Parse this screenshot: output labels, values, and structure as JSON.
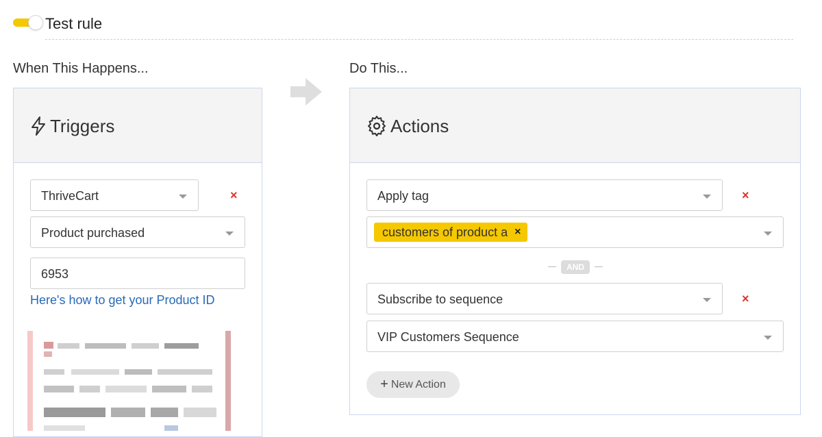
{
  "rule": {
    "name": "Test rule",
    "enabled": true
  },
  "sections": {
    "when": "When This Happens...",
    "do": "Do This..."
  },
  "triggers": {
    "title": "Triggers",
    "integration": "ThriveCart",
    "event": "Product purchased",
    "product_id": "6953",
    "help_link": "Here's how to get your Product ID",
    "delete_label": "×"
  },
  "actions": {
    "title": "Actions",
    "items": [
      {
        "type": "Apply tag",
        "tags": [
          "customers of product a"
        ],
        "delete_label": "×"
      },
      {
        "type": "Subscribe to sequence",
        "value": "VIP Customers Sequence",
        "delete_label": "×"
      }
    ],
    "separator": "AND",
    "new_action_label": "New Action"
  },
  "colors": {
    "accent": "#f5c800",
    "danger": "#e0342a",
    "link": "#2769b8",
    "panel_border": "#cbd6ef"
  }
}
